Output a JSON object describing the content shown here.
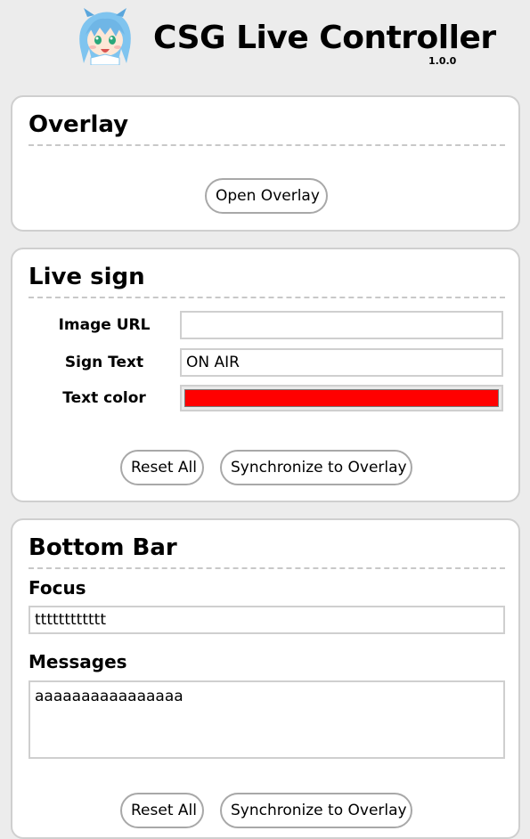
{
  "header": {
    "title": "CSG Live Controller",
    "version": "1.0.0",
    "avatar_icon": "anime-mascot-avatar"
  },
  "overlay": {
    "title": "Overlay",
    "open_label": "Open Overlay"
  },
  "live_sign": {
    "title": "Live sign",
    "image_url_label": "Image URL",
    "image_url_value": "",
    "sign_text_label": "Sign Text",
    "sign_text_value": "ON AIR",
    "text_color_label": "Text color",
    "text_color_value": "#ff0000",
    "reset_label": "Reset All",
    "sync_label": "Synchronize to Overlay"
  },
  "bottom_bar": {
    "title": "Bottom Bar",
    "focus_label": "Focus",
    "focus_value": "tttttttttttt",
    "messages_label": "Messages",
    "messages_value": "aaaaaaaaaaaaaaaa",
    "reset_label": "Reset All",
    "sync_label": "Synchronize to Overlay"
  },
  "colors": {
    "background": "#ececec",
    "panel": "#ffffff",
    "panel_border": "#cfcfcf",
    "button_border": "#a8a8a8",
    "mascot_hair": "#7fc4ef"
  }
}
